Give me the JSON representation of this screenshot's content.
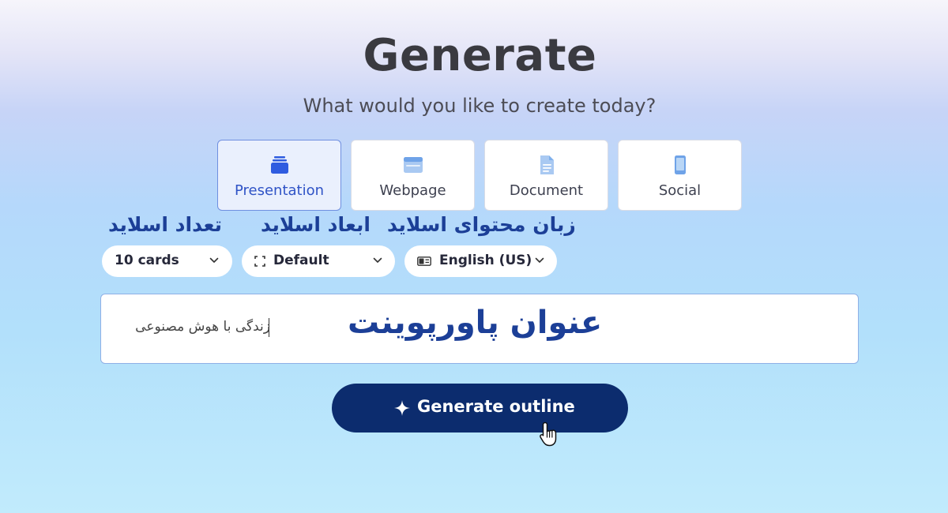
{
  "header": {
    "title": "Generate",
    "subtitle": "What would you like to create today?"
  },
  "types": [
    {
      "label": "Presentation",
      "icon": "stack-slides-icon",
      "selected": true
    },
    {
      "label": "Webpage",
      "icon": "browser-window-icon",
      "selected": false
    },
    {
      "label": "Document",
      "icon": "document-icon",
      "selected": false
    },
    {
      "label": "Social",
      "icon": "phone-icon",
      "selected": false
    }
  ],
  "annotations": {
    "card_count": "تعداد اسلاید",
    "dimensions": "ابعاد اسلاید",
    "language": "زبان محتوای اسلاید",
    "topic": "عنوان پاورپوینت"
  },
  "options": {
    "cards": "10 cards",
    "dimensions": "Default",
    "language": "English (US)"
  },
  "prompt": {
    "value": "زندگی با هوش مصنوعی"
  },
  "actions": {
    "generate_label": "Generate outline"
  },
  "colors": {
    "accent": "#2f53c6",
    "button": "#0c2c6e",
    "annotation": "#1c3f97"
  }
}
